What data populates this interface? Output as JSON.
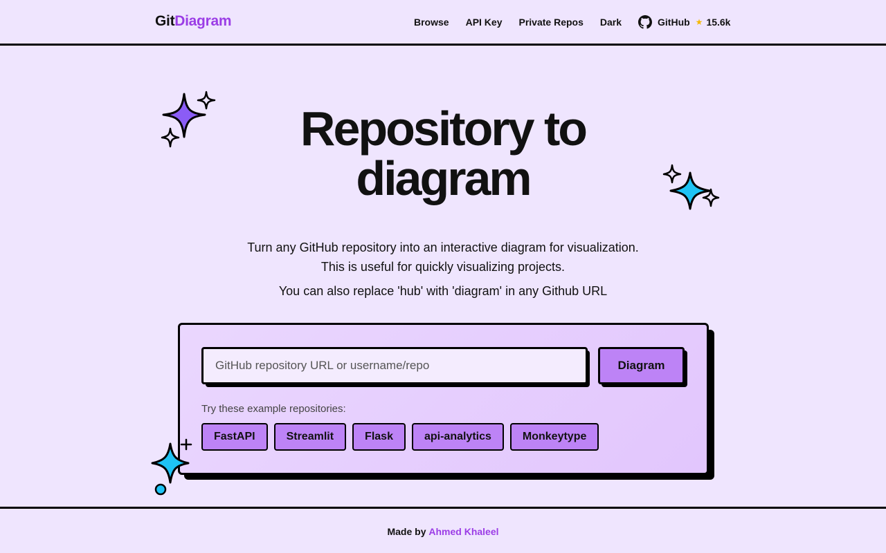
{
  "header": {
    "logo_part1": "Git",
    "logo_part2": "Diagram",
    "nav": {
      "browse": "Browse",
      "api_key": "API Key",
      "private_repos": "Private Repos",
      "dark": "Dark",
      "github": "GitHub",
      "stars": "15.6k"
    }
  },
  "hero": {
    "title_line1": "Repository to",
    "title_line2": "diagram",
    "subtitle_line1": "Turn any GitHub repository into an interactive diagram for visualization.",
    "subtitle_line2": "This is useful for quickly visualizing projects.",
    "subtitle_line3": "You can also replace 'hub' with 'diagram' in any Github URL"
  },
  "form": {
    "input_placeholder": "GitHub repository URL or username/repo",
    "input_value": "",
    "submit_label": "Diagram",
    "examples_label": "Try these example repositories:",
    "examples": [
      "FastAPI",
      "Streamlit",
      "Flask",
      "api-analytics",
      "Monkeytype"
    ]
  },
  "footer": {
    "made_by": "Made by",
    "author": "Ahmed Khaleel"
  },
  "colors": {
    "background": "#efe5fe",
    "brand_purple": "#9b3de6",
    "button_purple": "#bd83f6",
    "sparkle_purple": "#8b5cf6",
    "sparkle_cyan": "#1ec3f5",
    "star_gold": "#f5b800"
  }
}
